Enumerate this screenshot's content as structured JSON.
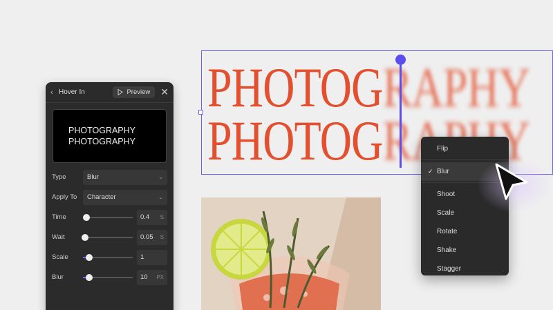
{
  "canvas": {
    "headline_lines": [
      {
        "sharp": "PHOTOG",
        "blurred": "RAPHY"
      },
      {
        "sharp": "PHOTOG",
        "blurred": "RAPHY"
      }
    ],
    "accent_color": "#5b4ef0",
    "text_color": "#e3502f"
  },
  "panel": {
    "title": "Hover In",
    "back_icon": "chevron-left-icon",
    "preview_label": "Preview",
    "close_icon": "close-icon",
    "preview_lines": [
      "PHOTOGRAPHY",
      "PHOTOGRAPHY"
    ],
    "type_label": "Type",
    "type_value": "Blur",
    "apply_label": "Apply To",
    "apply_value": "Character",
    "time_label": "Time",
    "time_value": "0.4",
    "time_unit": "S",
    "wait_label": "Wait",
    "wait_value": "0.05",
    "wait_unit": "S",
    "scale_label": "Scale",
    "scale_value": "1",
    "blur_label": "Blur",
    "blur_value": "10",
    "blur_unit": "PX"
  },
  "menu": {
    "items": [
      {
        "label": "Flip"
      },
      {
        "label": "Blur",
        "checked": true
      },
      {
        "label": "Shoot"
      },
      {
        "label": "Scale"
      },
      {
        "label": "Rotate"
      },
      {
        "label": "Shake"
      },
      {
        "label": "Stagger"
      }
    ]
  }
}
